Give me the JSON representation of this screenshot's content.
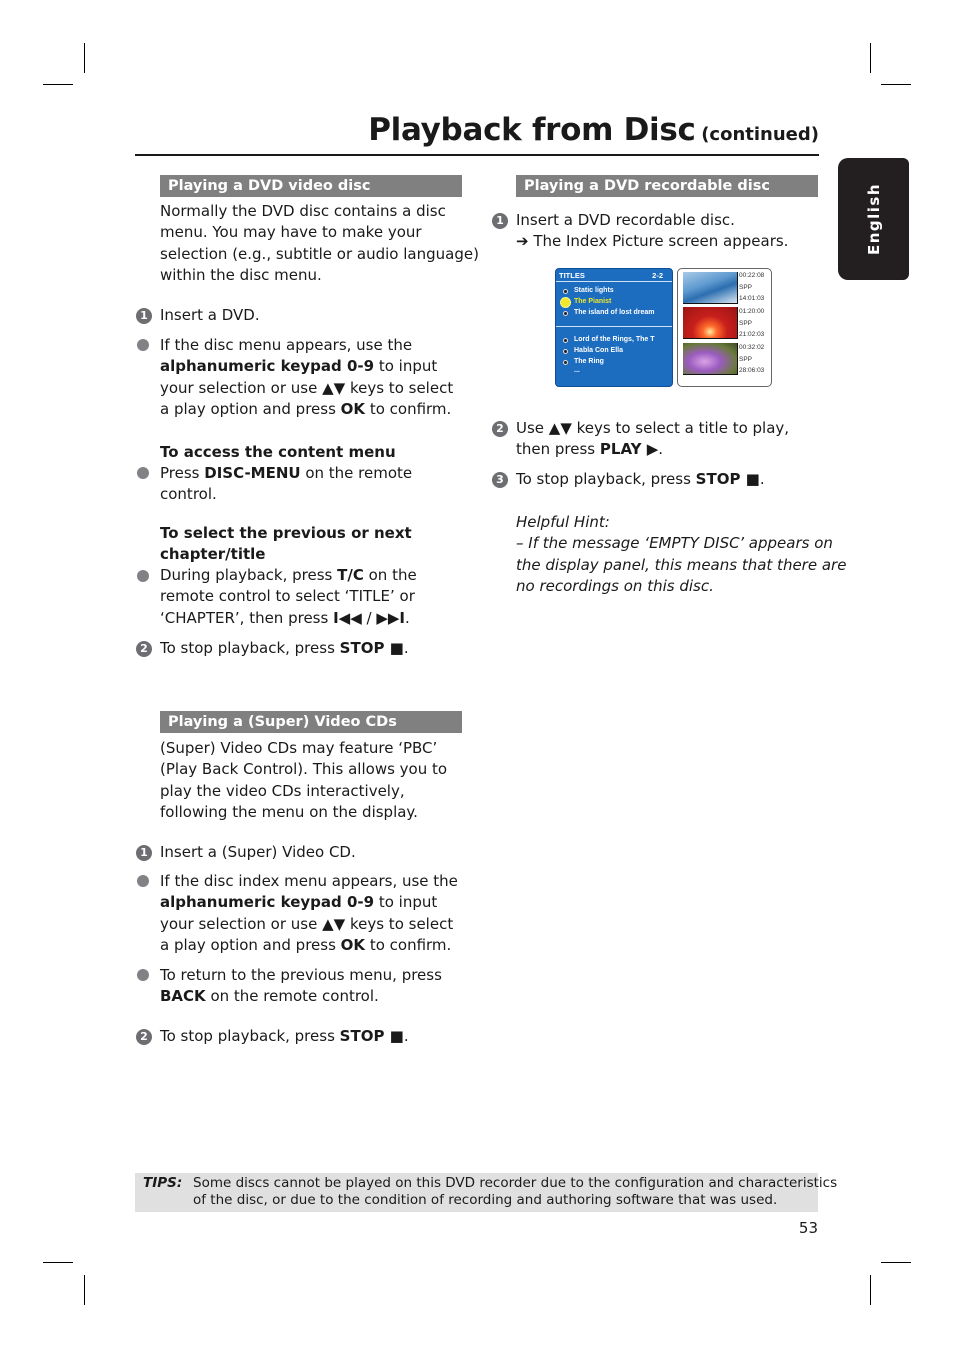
{
  "header": {
    "title": "Playback from Disc",
    "continued": "(continued)"
  },
  "language_tab": "English",
  "left": {
    "dvd_video": {
      "heading": "Playing a DVD video disc",
      "intro": [
        "Normally the DVD disc contains a disc",
        "menu. You may have to make your",
        "selection (e.g., subtitle or audio language)",
        "within the disc menu."
      ],
      "step1_num": "1",
      "step1": "Insert a DVD.",
      "bullet1": {
        "l1": "If the disc menu appears, use the",
        "l2_bold": "alphanumeric keypad 0-9",
        "l2_rest": " to input",
        "l3a": "your selection or use ",
        "l3_keys": "▲▼",
        "l3b": " keys to select",
        "l4a": "a play option and press ",
        "l4_bold": "OK",
        "l4b": " to confirm."
      },
      "content_menu": {
        "heading": "To access the content menu",
        "l1a": "Press ",
        "l1_bold": "DISC-MENU",
        "l1b": " on the remote",
        "l2": "control."
      },
      "chapter": {
        "heading1": "To select the previous or next",
        "heading2": "chapter/title",
        "l1a": "During playback, press ",
        "l1_bold": "T/C",
        "l1b": " on the",
        "l2": "remote control to select ‘TITLE’ or",
        "l3a": "‘CHAPTER’, then press ",
        "l3_prev": "I◀◀",
        "l3_sep": " / ",
        "l3_next": "▶▶I",
        "l3b": "."
      },
      "step2_num": "2",
      "step2a": "To stop playback, press ",
      "step2_bold": "STOP ■",
      "step2b": "."
    },
    "vcd": {
      "heading": "Playing a (Super) Video CDs",
      "intro": [
        "(Super) Video CDs may feature ‘PBC’",
        "(Play Back Control). This allows you to",
        "play the video CDs interactively,",
        "following the menu on the display."
      ],
      "step1_num": "1",
      "step1": "Insert a (Super) Video CD.",
      "bullet1": {
        "l1": "If the disc index menu appears, use the",
        "l2_bold": "alphanumeric keypad 0-9",
        "l2_rest": " to input",
        "l3a": "your selection or use ",
        "l3_keys": "▲▼",
        "l3b": " keys to select",
        "l4a": "a play option and press ",
        "l4_bold": "OK",
        "l4b": " to confirm."
      },
      "bullet2": {
        "l1": "To return to the previous menu, press",
        "l2_bold": "BACK",
        "l2_rest": " on the remote control."
      },
      "step2_num": "2",
      "step2a": "To stop playback, press ",
      "step2_bold": "STOP ■",
      "step2b": "."
    }
  },
  "right": {
    "heading": "Playing a DVD recordable disc",
    "step1_num": "1",
    "step1": "Insert a DVD recordable disc.",
    "step1_result": "➔ The Index Picture screen appears.",
    "index_screen": {
      "header": "TITLES",
      "page": "2-2",
      "group1": [
        "Static lights",
        "The Pianist",
        "The island of lost dream"
      ],
      "selected": "The Pianist",
      "group2": [
        "Lord of the Rings, The T",
        "Habla Con Ella",
        "The Ring",
        "..."
      ],
      "thumbs": [
        {
          "duration": "00:22:08",
          "mode": "SPP",
          "time": "14:01:03"
        },
        {
          "duration": "01:20:00",
          "mode": "SPP",
          "time": "21:02:03"
        },
        {
          "duration": "00:32:02",
          "mode": "SPP",
          "time": "28:06:03"
        }
      ]
    },
    "step2_num": "2",
    "step2a": "Use ",
    "step2_keys": "▲▼",
    "step2b": " keys to select a title to play,",
    "step2c": "then press ",
    "step2_bold": "PLAY ▶",
    "step2d": ".",
    "step3_num": "3",
    "step3a": "To stop playback, press ",
    "step3_bold": "STOP ■",
    "step3b": ".",
    "hint": {
      "title": "Helpful Hint:",
      "lines": [
        "–  If the message ‘EMPTY DISC’ appears on",
        "the display panel, this means that there are",
        "no recordings on this disc."
      ]
    }
  },
  "tips": {
    "label": "TIPS:",
    "lines": [
      "Some discs cannot be played on this DVD recorder due to the configuration and characteristics",
      "of the disc, or due to the condition of recording and authoring software that was used."
    ]
  },
  "page_number": "53",
  "colors": {
    "section_header_bg": "#808080",
    "tips_bg": "#e0e0e0",
    "lang_tab_bg": "#231f20",
    "osd_blue": "#1c6cc0",
    "osd_highlight": "#f0e82a"
  }
}
